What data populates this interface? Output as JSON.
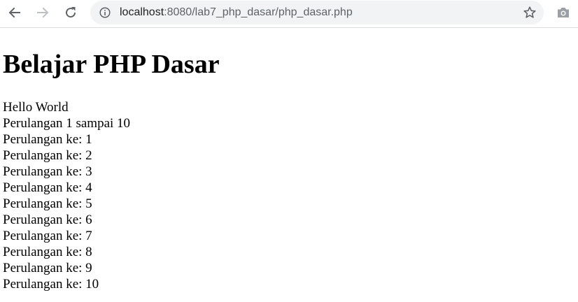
{
  "browser": {
    "url_host": "localhost",
    "url_rest": ":8080/lab7_php_dasar/php_dasar.php",
    "icons": {
      "back": "back-arrow-icon",
      "forward": "forward-arrow-icon",
      "reload": "reload-icon",
      "info": "info-icon",
      "bookmark": "star-icon",
      "camera": "camera-icon"
    },
    "colors": {
      "toolbar_bg": "#ffffff",
      "omnibox_bg": "#f1f3f4",
      "icon": "#5f6368",
      "icon_disabled": "#bdc1c6"
    }
  },
  "page": {
    "heading": "Belajar PHP Dasar",
    "lines": [
      "Hello World",
      "Perulangan 1 sampai 10",
      "Perulangan ke: 1",
      "Perulangan ke: 2",
      "Perulangan ke: 3",
      "Perulangan ke: 4",
      "Perulangan ke: 5",
      "Perulangan ke: 6",
      "Perulangan ke: 7",
      "Perulangan ke: 8",
      "Perulangan ke: 9",
      "Perulangan ke: 10"
    ]
  }
}
